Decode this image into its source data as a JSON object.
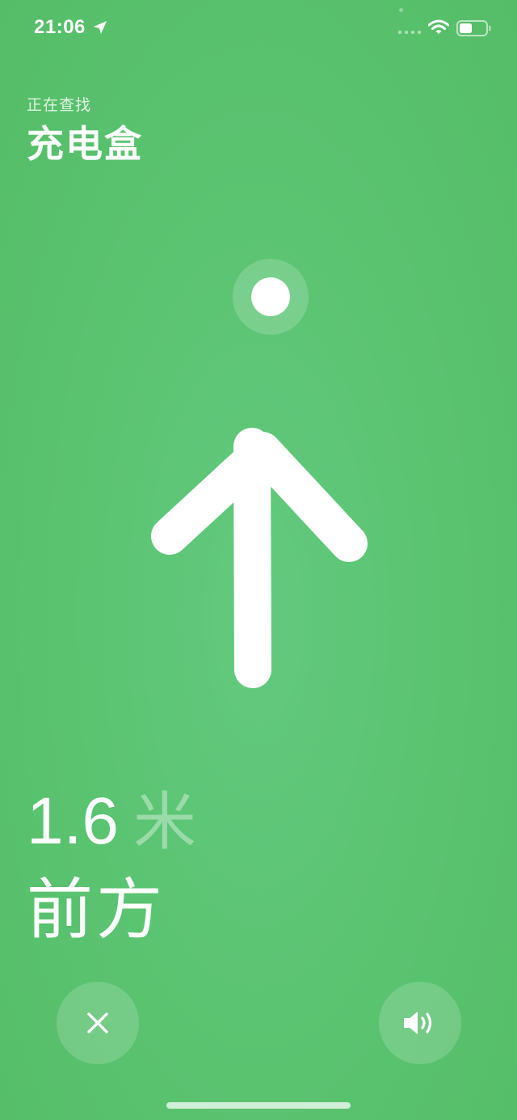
{
  "status_bar": {
    "time": "21:06",
    "icons": [
      "location-arrow-icon",
      "cellular-signal-icon",
      "wifi-icon",
      "battery-icon"
    ]
  },
  "header": {
    "subtitle": "正在查找",
    "title": "充电盒"
  },
  "finder": {
    "distance_value": "1.6",
    "distance_unit": "米",
    "direction": "前方"
  },
  "controls": {
    "close_icon": "close-icon",
    "sound_icon": "speaker-icon"
  },
  "colors": {
    "background": "#5bc472",
    "foreground": "#ffffff"
  }
}
